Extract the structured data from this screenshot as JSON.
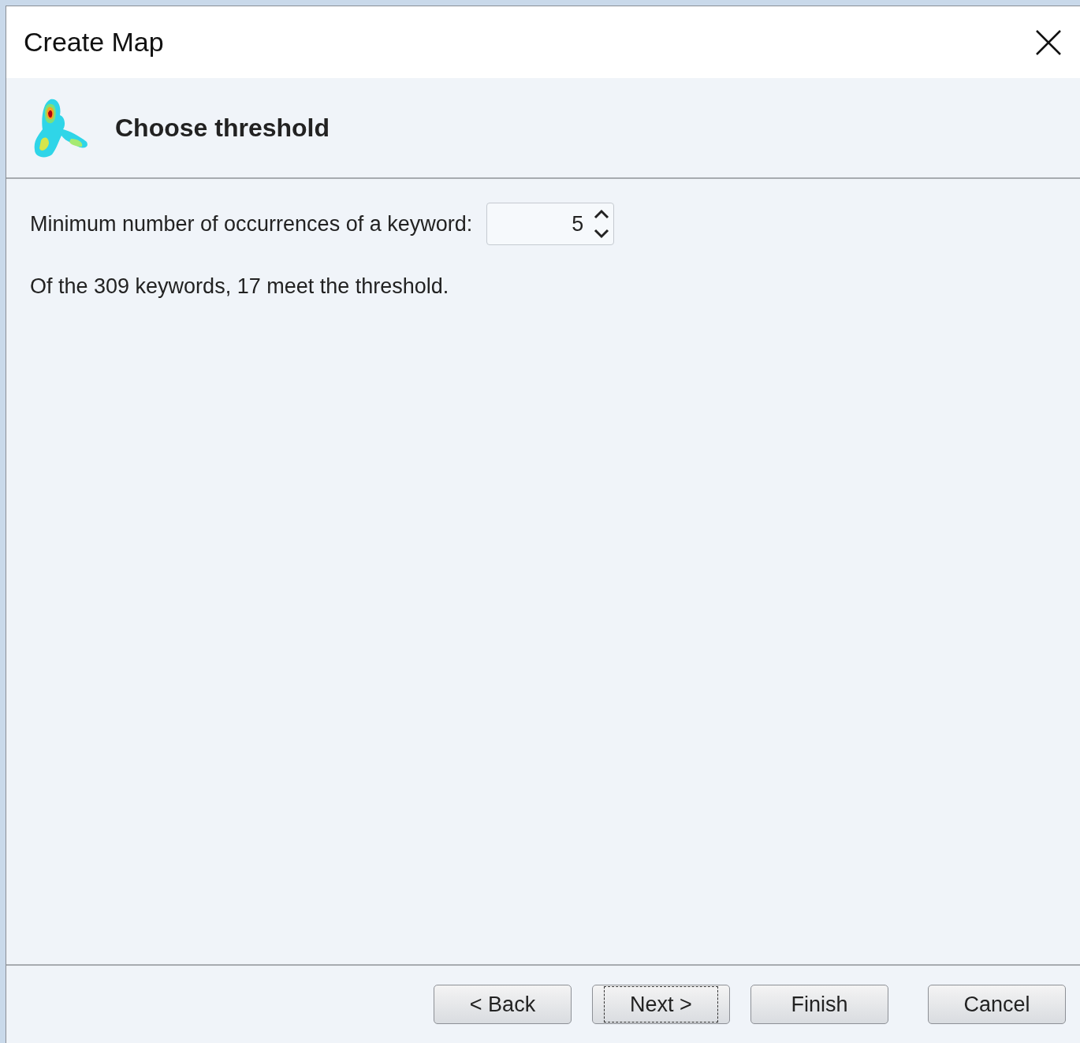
{
  "window": {
    "title": "Create Map"
  },
  "header": {
    "title": "Choose threshold"
  },
  "threshold": {
    "label": "Minimum number of occurrences of a keyword:",
    "value": "5"
  },
  "summary": "Of the 309 keywords, 17 meet the threshold.",
  "buttons": [
    {
      "label": "< Back",
      "focused": false
    },
    {
      "label": "Next >",
      "focused": true
    },
    {
      "label": "Finish",
      "focused": false
    },
    {
      "label": "Cancel",
      "focused": false
    }
  ]
}
